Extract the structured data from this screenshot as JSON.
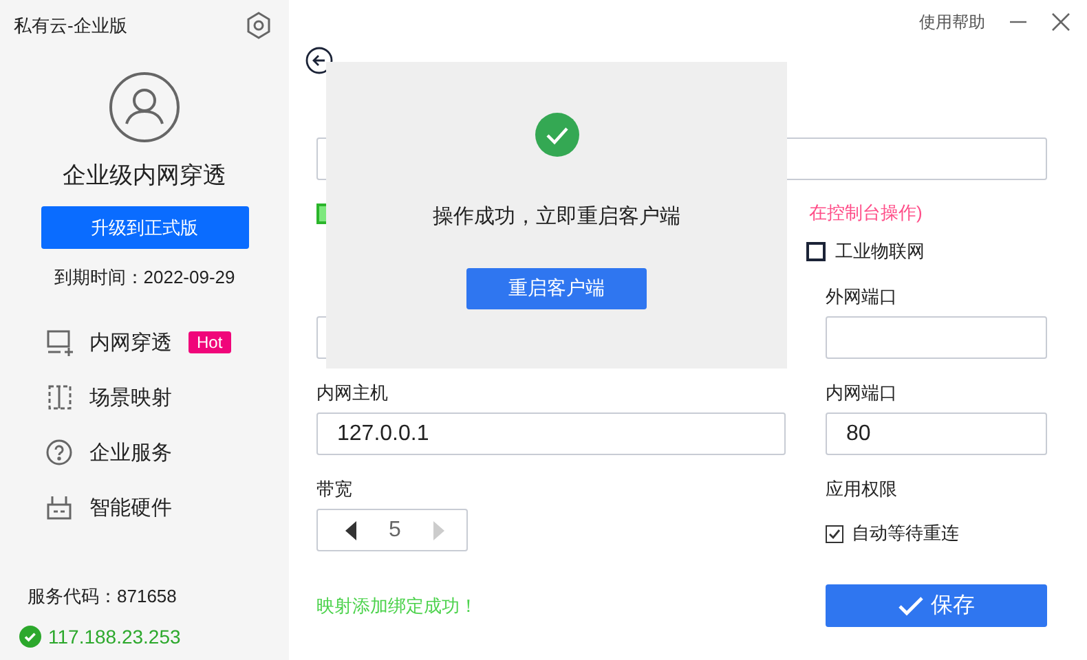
{
  "sidebar": {
    "app_title": "私有云-企业版",
    "product": "企业级内网穿透",
    "upgrade_button": "升级到正式版",
    "expiry": "到期时间：2022-09-29",
    "items": [
      {
        "kind": "tunnel",
        "label": "内网穿透",
        "badge": "Hot"
      },
      {
        "kind": "scene",
        "label": "场景映射"
      },
      {
        "kind": "service",
        "label": "企业服务"
      },
      {
        "kind": "hardware",
        "label": "智能硬件"
      }
    ],
    "service_code": "服务代码：871658",
    "ip": "117.188.23.253",
    "online": true
  },
  "header": {
    "help": "使用帮助"
  },
  "form": {
    "hint": "在控制台操作)",
    "green_check": true,
    "iot": {
      "label": "工业物联网",
      "checked": false
    },
    "public_port_label": "外网端口",
    "host_label": "内网主机",
    "host_value": "127.0.0.1",
    "port_label": "内网端口",
    "port_value": "80",
    "bandwidth_label": "带宽",
    "bandwidth_value": "5",
    "permission_label": "应用权限",
    "auto_reconnect": {
      "label": "自动等待重连",
      "checked": true
    },
    "message": "映射添加绑定成功！",
    "save_button": "保存"
  },
  "dialog": {
    "message": "操作成功，立即重启客户端",
    "button": "重启客户端"
  }
}
